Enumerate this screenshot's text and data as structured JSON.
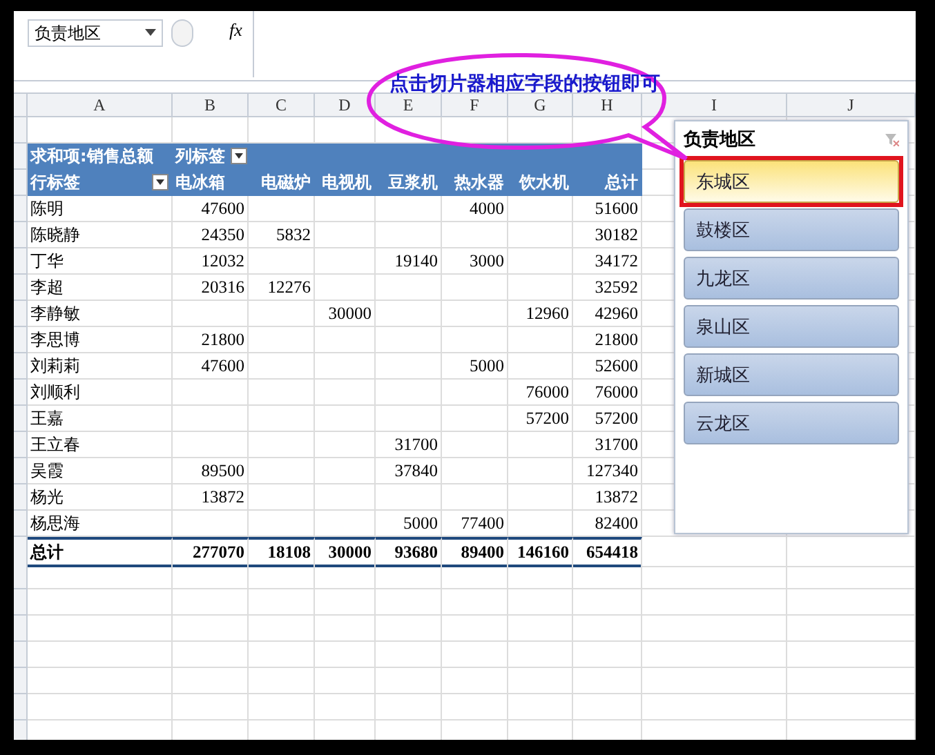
{
  "formula_bar": {
    "name_box": "负责地区",
    "function_label": "fx"
  },
  "columns": [
    "A",
    "B",
    "C",
    "D",
    "E",
    "F",
    "G",
    "H",
    "I",
    "J"
  ],
  "pivot": {
    "value_label": "求和项:销售总额",
    "column_label": "列标签",
    "row_label": "行标签",
    "headers": [
      "电冰箱",
      "电磁炉",
      "电视机",
      "豆浆机",
      "热水器",
      "饮水机",
      "总计"
    ],
    "rows": [
      {
        "name": "陈明",
        "b": "47600",
        "f": "4000",
        "h": "51600"
      },
      {
        "name": "陈晓静",
        "b": "24350",
        "c": "5832",
        "h": "30182"
      },
      {
        "name": "丁华",
        "b": "12032",
        "e": "19140",
        "f": "3000",
        "h": "34172"
      },
      {
        "name": "李超",
        "b": "20316",
        "c": "12276",
        "h": "32592"
      },
      {
        "name": "李静敏",
        "d": "30000",
        "g": "12960",
        "h": "42960"
      },
      {
        "name": "李思博",
        "b": "21800",
        "h": "21800"
      },
      {
        "name": "刘莉莉",
        "b": "47600",
        "f": "5000",
        "h": "52600"
      },
      {
        "name": "刘顺利",
        "g": "76000",
        "h": "76000"
      },
      {
        "name": "王嘉",
        "g": "57200",
        "h": "57200"
      },
      {
        "name": "王立春",
        "e": "31700",
        "h": "31700"
      },
      {
        "name": "吴霞",
        "b": "89500",
        "e": "37840",
        "h": "127340"
      },
      {
        "name": "杨光",
        "b": "13872",
        "h": "13872"
      },
      {
        "name": "杨思海",
        "e": "5000",
        "f": "77400",
        "h": "82400"
      }
    ],
    "total": {
      "name": "总计",
      "b": "277070",
      "c": "18108",
      "d": "30000",
      "e": "93680",
      "f": "89400",
      "g": "146160",
      "h": "654418"
    }
  },
  "slicer": {
    "title": "负责地区",
    "items": [
      {
        "label": "东城区",
        "selected": true,
        "highlighted": true
      },
      {
        "label": "鼓楼区",
        "selected": false,
        "highlighted": false
      },
      {
        "label": "九龙区",
        "selected": false,
        "highlighted": false
      },
      {
        "label": "泉山区",
        "selected": false,
        "highlighted": false
      },
      {
        "label": "新城区",
        "selected": false,
        "highlighted": false
      },
      {
        "label": "云龙区",
        "selected": false,
        "highlighted": false
      }
    ]
  },
  "callout": {
    "text": "点击切片器相应字段的按钮即可"
  }
}
